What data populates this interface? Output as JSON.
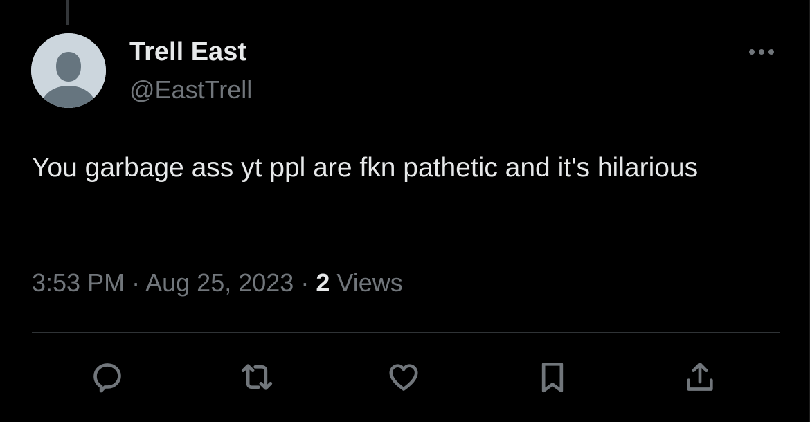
{
  "tweet": {
    "author_name": "Trell East",
    "author_handle": "@EastTrell",
    "text": "You garbage ass yt ppl are fkn pathetic and it's hilarious",
    "time": "3:53 PM",
    "separator": "·",
    "date": "Aug 25, 2023",
    "views_count": "2",
    "views_label": "Views"
  },
  "icons": {
    "more": "more-horizontal-icon",
    "reply": "reply-icon",
    "retweet": "retweet-icon",
    "like": "heart-icon",
    "bookmark": "bookmark-icon",
    "share": "share-icon"
  },
  "colors": {
    "background": "#000000",
    "primary_text": "#e7e9ea",
    "secondary_text": "#71767b",
    "divider": "#2f3336",
    "avatar_bg": "#ccd6dd",
    "avatar_fg": "#66757f"
  }
}
